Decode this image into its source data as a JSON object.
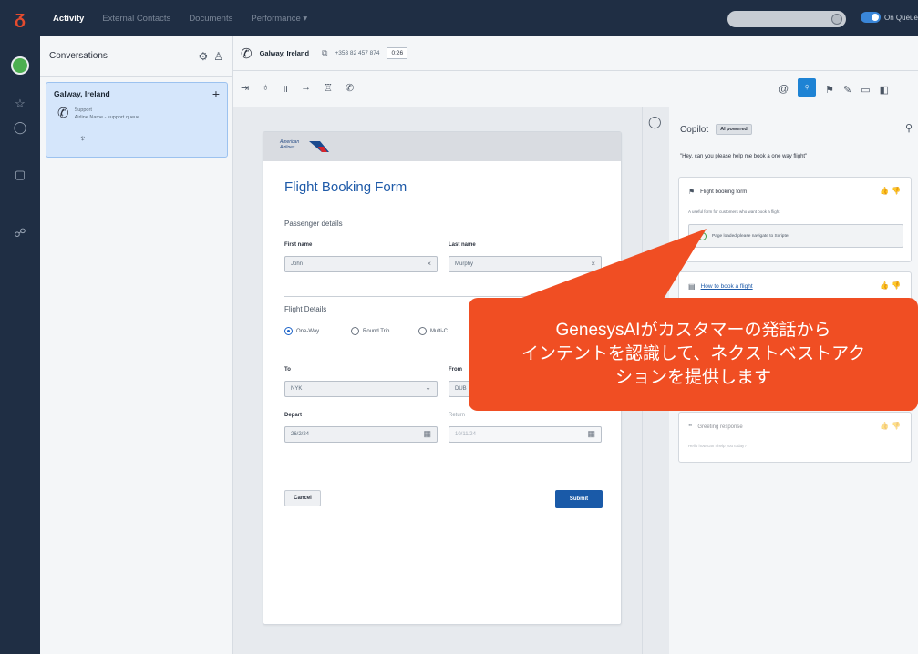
{
  "topbar": {
    "nav": [
      "Activity",
      "External Contacts",
      "Documents",
      "Performance ▾"
    ],
    "status_text": "On Queue"
  },
  "conversations": {
    "title": "Conversations",
    "card": {
      "title": "Galway, Ireland",
      "line1": "Support",
      "line2": "Airline Name - support queue"
    }
  },
  "call": {
    "location": "Galway, Ireland",
    "number": "+353 82 457 874",
    "timer": "0:26"
  },
  "form": {
    "brand": [
      "American",
      "Airlines"
    ],
    "title": "Flight Booking Form",
    "passenger_section": "Passenger details",
    "first_name_label": "First name",
    "first_name_value": "John",
    "last_name_label": "Last name",
    "last_name_value": "Murphy",
    "flight_section": "Flight Details",
    "radio_one_way": "One-Way",
    "radio_round_trip": "Round Trip",
    "radio_multi": "Multi-C",
    "to_label": "To",
    "to_value": "NYK",
    "from_label": "From",
    "from_value": "DUB",
    "depart_label": "Depart",
    "depart_value": "26/2/24",
    "return_label": "Return",
    "return_value": "10/11/24",
    "cancel_label": "Cancel",
    "submit_label": "Submit"
  },
  "copilot": {
    "title": "Copilot",
    "badge": "AI powered",
    "quote": "\"Hey, can you please help me book a one way flight\"",
    "card1_title": "Flight booking form",
    "card1_desc": "A useful form for customers who want book a flight",
    "card1_inner": "Page loaded please navigate to Scripter",
    "card2_link": "How to book a flight",
    "card3_title": "Greeting response",
    "card3_desc": "Hello how can I help you today?"
  },
  "callout": {
    "line1": "GenesysAIがカスタマーの発話から",
    "line2": "インテントを認識して、ネクストベストアク",
    "line3": "ションを提供します"
  },
  "colors": {
    "navy": "#1f2e44",
    "accent_blue": "#1e83d4",
    "callout_orange": "#f04e23",
    "form_title_blue": "#1e5aa8"
  }
}
